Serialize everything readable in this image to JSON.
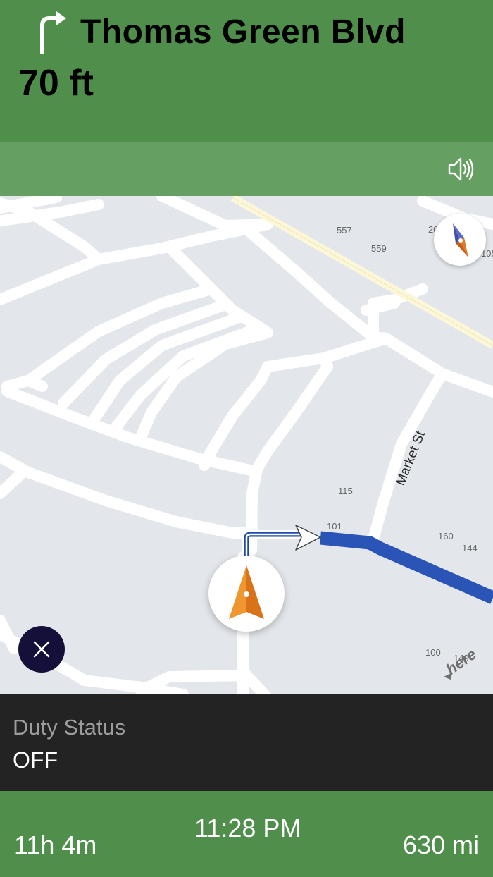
{
  "maneuver": {
    "icon": "turn-right-arrow-icon",
    "street": "Thomas Green Blvd",
    "distance": "70 ft"
  },
  "audio": {
    "icon": "speaker-icon"
  },
  "map": {
    "street_labels": [
      "Market St"
    ],
    "address_labels": [
      "557",
      "20",
      "559",
      "105",
      "115",
      "101",
      "160",
      "144",
      "100",
      "149"
    ],
    "provider_logo": "here",
    "colors": {
      "background": "#e3e6ea",
      "road": "#ffffff",
      "major_road": "#fbf7d8",
      "route": "#2a55b6"
    }
  },
  "compass": {
    "icon": "compass-icon"
  },
  "vehicle": {
    "icon": "navigation-arrow-icon"
  },
  "close": {
    "icon": "close-icon"
  },
  "duty": {
    "label": "Duty Status",
    "value": "OFF"
  },
  "footer": {
    "remaining_time": "11h 4m",
    "arrival_time": "11:28 PM",
    "remaining_distance": "630 mi"
  },
  "colors": {
    "header_green": "#4f8f4b",
    "subbar_green": "#659f62",
    "duty_panel": "#232323",
    "close_button": "#14103a"
  }
}
